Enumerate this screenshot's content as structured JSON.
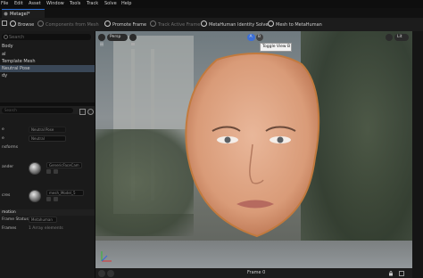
{
  "menu": {
    "items": [
      "File",
      "Edit",
      "Asset",
      "Window",
      "Tools",
      "Track",
      "Solve",
      "Help"
    ]
  },
  "tab": {
    "title": "Metagel*"
  },
  "toolbar": {
    "browse": "Browse",
    "components_from_mesh": "Components from Mesh",
    "promote_frame": "Promote Frame",
    "track_active_frame": "Track Active Frame",
    "identity_solve": "MetaHuman Identity Solve",
    "mesh_to_metahuman": "Mesh to MetaHuman"
  },
  "outliner": {
    "search_placeholder": "Search",
    "rows": [
      {
        "label": "Body",
        "selected": false
      },
      {
        "label": "al",
        "selected": false
      },
      {
        "label": "Template Mesh",
        "selected": false
      },
      {
        "label": "Neutral Pose",
        "selected": true
      },
      {
        "label": "dy",
        "selected": false
      }
    ]
  },
  "details": {
    "search_placeholder": "Search",
    "props": [
      {
        "label": "e",
        "value": "Neutral Pose"
      },
      {
        "label": "e",
        "value": "Neutral"
      },
      {
        "label": "nsforms",
        "value": ""
      }
    ],
    "asset1": {
      "label": "ander",
      "value": "GenericFaceCam"
    },
    "asset2": {
      "label": "cres",
      "value": "mesh_Model_5"
    },
    "section_promotion": "motion",
    "frame_status_label": "Frame Status",
    "frame_status_value": "Metahuman",
    "frames_label": "Frames",
    "frames_value": "1 Array elements"
  },
  "viewport": {
    "view_label": "Lit",
    "tooltip": "Toggle View B",
    "frame_label": "Frame 0",
    "buttons": {
      "a": "A",
      "b": "B",
      "perspective": "Persp"
    }
  },
  "colors": {
    "accent": "#2a6fdb",
    "selection": "#3a4757",
    "panel": "#1a1a1a"
  }
}
